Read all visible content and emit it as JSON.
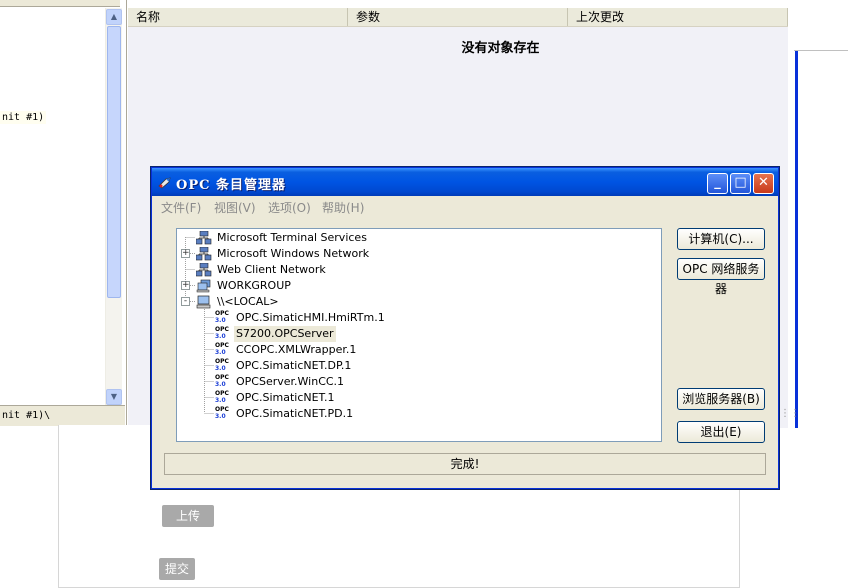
{
  "background": {
    "left_tag_1": "nit #1)",
    "left_tag_2": "nit #1)\\",
    "list_columns": [
      "名称",
      "参数",
      "上次更改"
    ],
    "empty_message": "没有对象存在",
    "upload_button": "上传",
    "submit_button": "提交"
  },
  "dialog": {
    "title": "OPC 条目管理器",
    "menu": [
      "文件(F)",
      "视图(V)",
      "选项(O)",
      "帮助(H)"
    ],
    "tree": [
      {
        "label": "Microsoft Terminal Services",
        "icon": "network-icon",
        "expander": ""
      },
      {
        "label": "Microsoft Windows Network",
        "icon": "network-icon",
        "expander": "+"
      },
      {
        "label": "Web Client Network",
        "icon": "network-icon",
        "expander": ""
      },
      {
        "label": "WORKGROUP",
        "icon": "workgroup-icon",
        "expander": "+"
      },
      {
        "label": "\\\\<LOCAL>",
        "icon": "computer-icon",
        "expander": "-"
      },
      {
        "label": "OPC.SimaticHMI.HmiRTm.1",
        "icon": "opc-server-icon"
      },
      {
        "label": "S7200.OPCServer",
        "icon": "opc-server-icon",
        "selected": true
      },
      {
        "label": "CCOPC.XMLWrapper.1",
        "icon": "opc-server-icon"
      },
      {
        "label": "OPC.SimaticNET.DP.1",
        "icon": "opc-server-icon"
      },
      {
        "label": "OPCServer.WinCC.1",
        "icon": "opc-server-icon"
      },
      {
        "label": "OPC.SimaticNET.1",
        "icon": "opc-server-icon"
      },
      {
        "label": "OPC.SimaticNET.PD.1",
        "icon": "opc-server-icon"
      }
    ],
    "opc_icon_top": "OPC",
    "opc_icon_bottom": "3.0",
    "buttons": {
      "computer": "计算机(C)...",
      "opc_network": "OPC 网络服务器",
      "browse": "浏览服务器(B)",
      "exit": "退出(E)"
    },
    "status": "完成!",
    "window_controls": {
      "minimize": "_",
      "maximize": "□",
      "close": "✕"
    }
  },
  "colors": {
    "titlebar": "#0054e3",
    "dialog_face": "#ece9d8",
    "tree_border": "#7f9db9",
    "close_button": "#c8391b"
  }
}
